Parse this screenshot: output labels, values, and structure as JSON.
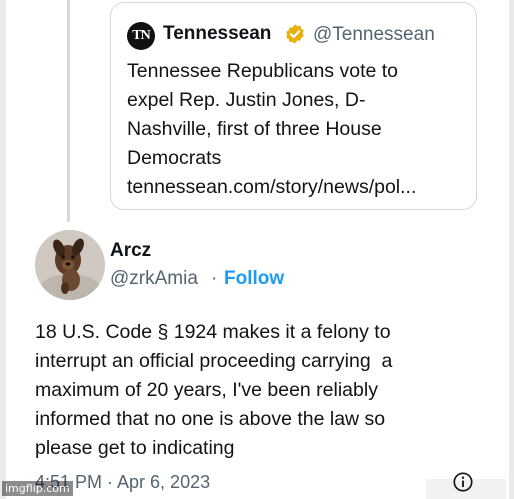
{
  "quoted_tweet": {
    "logo_text": "TN",
    "display_name": "Tennessean",
    "handle": "@Tennessean",
    "text_lines": [
      "Tennessee Republicans vote to",
      "expel Rep. Justin Jones, D-",
      "Nashville, first of three House",
      "Democrats",
      "tennessean.com/story/news/pol..."
    ]
  },
  "tweet": {
    "display_name": "Arcz",
    "handle": "@zrkAmia",
    "separator": "·",
    "follow_label": "Follow",
    "text_lines": [
      "18 U.S. Code § 1924 makes it a felony to",
      "interrupt an official proceeding carrying  a",
      "maximum of 20 years, I've been reliably",
      "informed that no one is above the law so",
      "please get to indicating"
    ],
    "timestamp": "4:51 PM · Apr 6, 2023"
  },
  "watermark": "imgflip.com",
  "colors": {
    "accent": "#1d9bf0",
    "verified": "#e8b008",
    "text": "#0f1419",
    "muted": "#536471"
  },
  "icons": {
    "verified": "verified-badge-icon",
    "info": "info-icon"
  }
}
